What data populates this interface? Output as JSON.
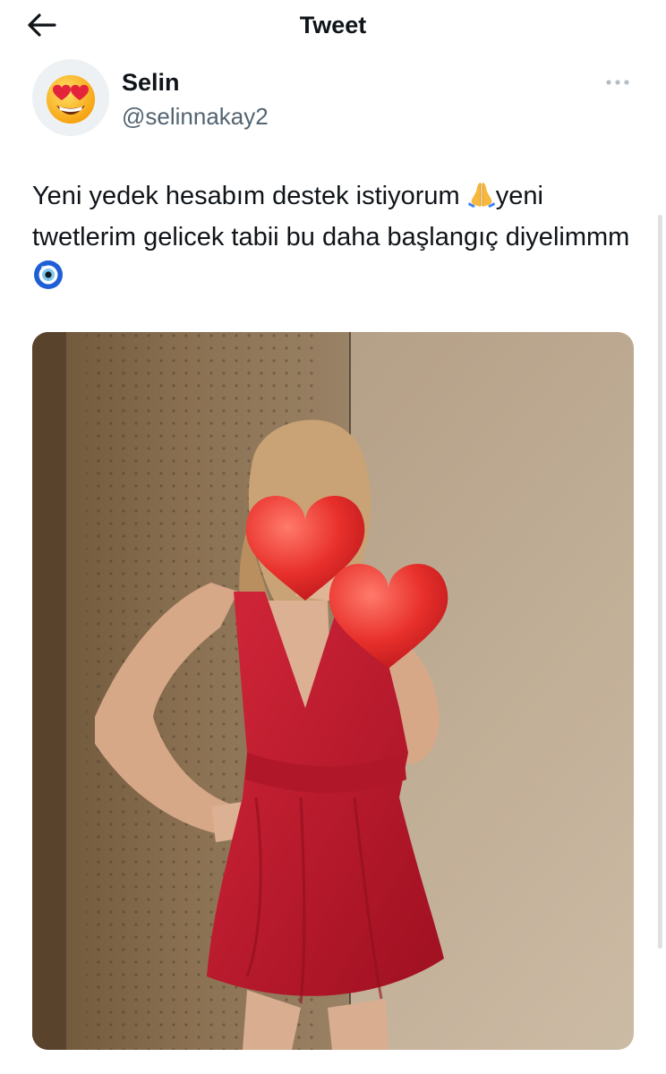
{
  "header": {
    "title": "Tweet",
    "back_icon": "arrow-left-icon"
  },
  "author": {
    "display_name": "Selin",
    "handle": "@selinnakay2",
    "avatar_icon": "heart-eyes-emoji-avatar",
    "more_icon": "more-horizontal-icon"
  },
  "tweet": {
    "text_part1": "Yeni yedek hesabım destek istiyorum ",
    "emoji1": "folded-hands-emoji",
    "text_part2": "yeni twetlerim gelicek tabii bu daha başlangıç diyelimmm",
    "emoji2": "nazar-amulet-emoji"
  },
  "media": {
    "content": "photo of a woman in a red dress with heart stickers",
    "dress_color": "#c62032",
    "heart_color": "#e8302b"
  },
  "colors": {
    "text": "#0f1419",
    "secondary_text": "#536471",
    "background": "#ffffff"
  }
}
